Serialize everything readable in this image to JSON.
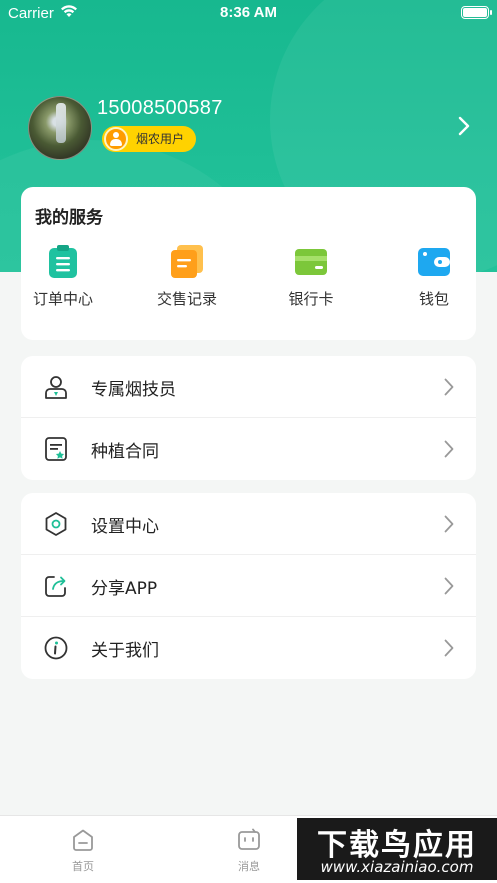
{
  "status_bar": {
    "carrier": "Carrier",
    "time": "8:36 AM"
  },
  "profile": {
    "phone": "15008500587",
    "badge": "烟农用户"
  },
  "services": {
    "title": "我的服务",
    "items": [
      {
        "label": "订单中心",
        "icon": "clipboard-icon",
        "color": "#1fc2a0"
      },
      {
        "label": "交售记录",
        "icon": "records-icon",
        "color": "#ff9f1a"
      },
      {
        "label": "银行卡",
        "icon": "bank-card-icon",
        "color": "#7cc73a"
      },
      {
        "label": "钱包",
        "icon": "wallet-icon",
        "color": "#1ea8f0"
      }
    ]
  },
  "menu_group1": [
    {
      "label": "专属烟技员",
      "icon": "technician-icon"
    },
    {
      "label": "种植合同",
      "icon": "contract-icon"
    }
  ],
  "menu_group2": [
    {
      "label": "设置中心",
      "icon": "settings-icon"
    },
    {
      "label": "分享APP",
      "icon": "share-icon"
    },
    {
      "label": "关于我们",
      "icon": "info-icon"
    }
  ],
  "tabbar": {
    "tabs": [
      {
        "label": "首页",
        "icon": "home-icon"
      },
      {
        "label": "消息",
        "icon": "message-icon"
      }
    ]
  },
  "watermark": {
    "line1": "下载鸟应用",
    "line2": "www.xiazainiao.com"
  },
  "colors": {
    "header_green": "#1fbf97",
    "badge_yellow": "#ffd200"
  }
}
